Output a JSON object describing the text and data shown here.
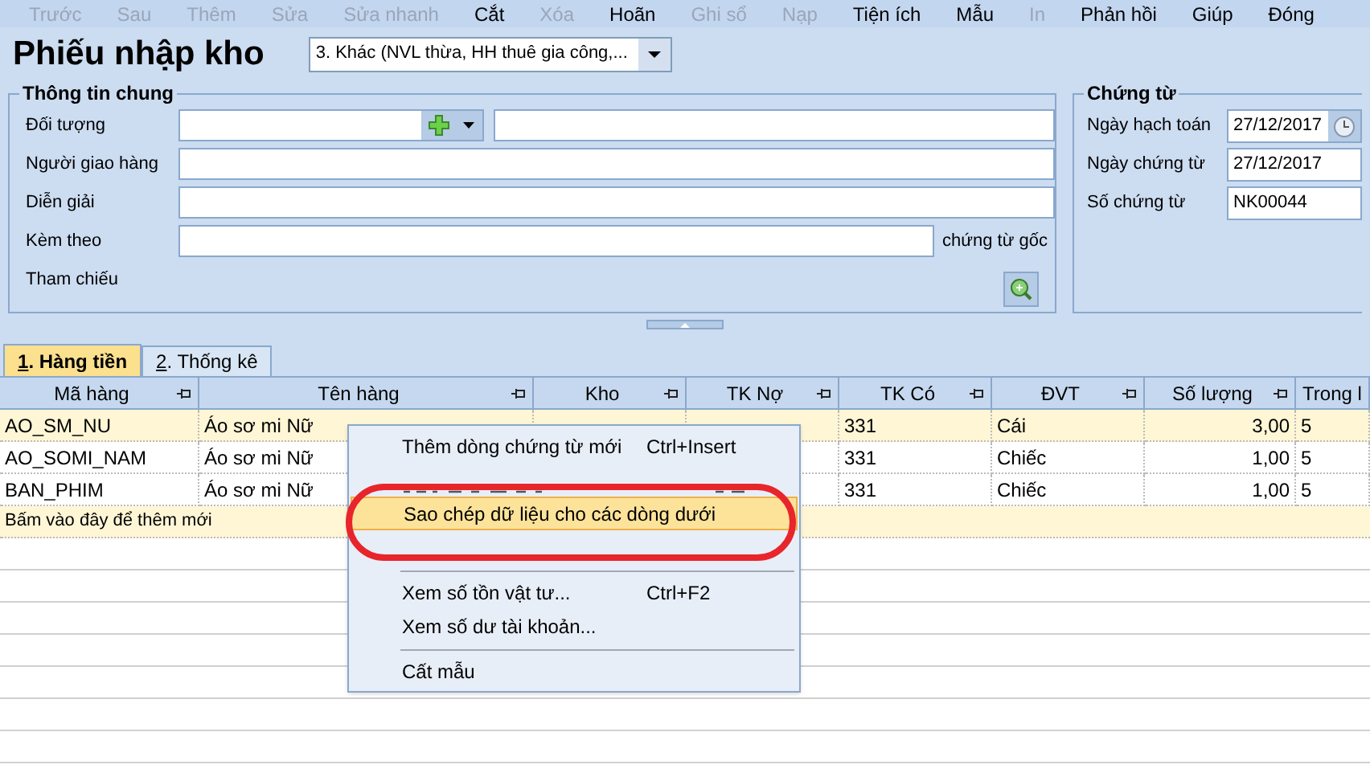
{
  "toolbar": [
    {
      "label": "Trước",
      "disabled": true
    },
    {
      "label": "Sau",
      "disabled": true
    },
    {
      "label": "Thêm",
      "disabled": true
    },
    {
      "label": "Sửa",
      "disabled": true
    },
    {
      "label": "Sửa nhanh",
      "disabled": true
    },
    {
      "label": "Cắt",
      "disabled": false
    },
    {
      "label": "Xóa",
      "disabled": true
    },
    {
      "label": "Hoãn",
      "disabled": false
    },
    {
      "label": "Ghi sổ",
      "disabled": true
    },
    {
      "label": "Nạp",
      "disabled": true
    },
    {
      "label": "Tiện ích",
      "disabled": false
    },
    {
      "label": "Mẫu",
      "disabled": false
    },
    {
      "label": "In",
      "disabled": true
    },
    {
      "label": "Phản hồi",
      "disabled": false
    },
    {
      "label": "Giúp",
      "disabled": false
    },
    {
      "label": "Đóng",
      "disabled": false
    }
  ],
  "title": "Phiếu nhập kho",
  "voucher_type": "3. Khác (NVL thừa, HH thuê gia công,...",
  "general": {
    "title": "Thông tin chung",
    "fields": [
      {
        "label": "Đối tượng",
        "kind": "object"
      },
      {
        "label": "Người giao hàng",
        "kind": "text"
      },
      {
        "label": "Diễn giải",
        "kind": "text"
      },
      {
        "label": "Kèm theo",
        "kind": "attach",
        "suffix": "chứng từ gốc"
      },
      {
        "label": "Tham chiếu",
        "kind": "reference"
      }
    ]
  },
  "voucher": {
    "title": "Chứng từ",
    "fields": [
      {
        "label": "Ngày hạch toán",
        "value": "27/12/2017",
        "kind": "date"
      },
      {
        "label": "Ngày chứng từ",
        "value": "27/12/2017",
        "kind": "text"
      },
      {
        "label": "Số chứng từ",
        "value": "NK00044",
        "kind": "text"
      }
    ]
  },
  "tabs": [
    {
      "label": "Hàng tiền",
      "index": "1.",
      "selected": true
    },
    {
      "label": "Thống kê",
      "index": "2.",
      "selected": false
    }
  ],
  "table": {
    "columns": [
      "Mã hàng",
      "Tên hàng",
      "Kho",
      "TK Nợ",
      "TK Có",
      "ĐVT",
      "Số lượng",
      "Trong l"
    ],
    "rows": [
      {
        "selected": true,
        "cells": [
          "AO_SM_NU",
          "Áo sơ mi Nữ",
          null,
          null,
          "331",
          "Cái",
          "3,00",
          "5"
        ]
      },
      {
        "selected": false,
        "cells": [
          "AO_SOMI_NAM",
          "Áo sơ mi Nữ",
          null,
          null,
          "331",
          "Chiếc",
          "1,00",
          "5"
        ]
      },
      {
        "selected": false,
        "cells": [
          "BAN_PHIM",
          "Áo sơ mi Nữ",
          null,
          null,
          "331",
          "Chiếc",
          "1,00",
          "5"
        ]
      }
    ],
    "new_row": "Bấm vào đây để thêm mới"
  },
  "context_menu": [
    {
      "label": "Thêm dòng chứng từ mới",
      "shortcut": "Ctrl+Insert",
      "highlighted": false,
      "separator_before": false
    },
    {
      "kind": "obscured"
    },
    {
      "label": "Sao chép dữ liệu cho các dòng dưới",
      "highlighted": true,
      "separator_before": false
    },
    {
      "kind": "obscured"
    },
    {
      "label": "Xem số tồn vật tư...",
      "shortcut": "Ctrl+F2",
      "highlighted": false,
      "separator_before": true
    },
    {
      "label": "Xem số dư tài khoản...",
      "highlighted": false,
      "separator_before": false
    },
    {
      "label": "Cất mẫu",
      "highlighted": false,
      "separator_before": true
    }
  ]
}
